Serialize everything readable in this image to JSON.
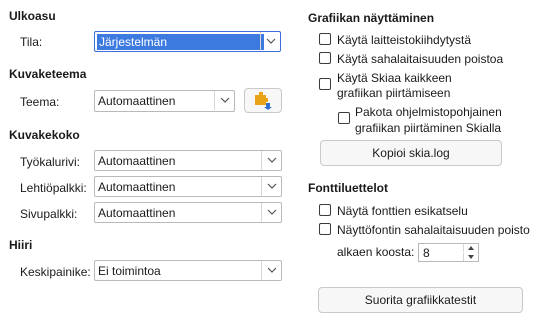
{
  "left": {
    "ulkoasu": {
      "title": "Ulkoasu",
      "mode_label": "Tila:",
      "mode_value": "Järjestelmän"
    },
    "icon_theme": {
      "title": "Kuvaketeema",
      "theme_label": "Teema:",
      "theme_value": "Automaattinen"
    },
    "icon_size": {
      "title": "Kuvakekoko",
      "toolbar_label": "Työkalurivi:",
      "toolbar_value": "Automaattinen",
      "notebookbar_label": "Lehtiöpalkki:",
      "notebookbar_value": "Automaattinen",
      "sidebar_label": "Sivupalkki:",
      "sidebar_value": "Automaattinen"
    },
    "mouse": {
      "title": "Hiiri",
      "middle_label": "Keskipainike:",
      "middle_value": "Ei toimintoa"
    }
  },
  "right": {
    "graphics": {
      "title": "Grafiikan näyttäminen",
      "hw_accel": "Käytä laitteistokiihdytystä",
      "antialias": "Käytä sahalaitaisuuden poistoa",
      "skia_line1": "Käytä Skiaa kaikkeen",
      "skia_line2": "grafiikan piirtämiseen",
      "force_skia_line1": "Pakota ohjelmistopohjainen",
      "force_skia_line2": "grafiikan piirtäminen Skialla",
      "copy_button": "Kopioi skia.log"
    },
    "font_lists": {
      "title": "Fonttiluettelot",
      "preview": "Näytä fonttien esikatselu",
      "font_aa": "Näyttöfontin sahalaitaisuuden poisto",
      "from_size_label": "alkaen koosta:",
      "from_size_value": "8"
    },
    "run_tests_button": "Suorita grafiikkatestit"
  },
  "colors": {
    "accent": "#3d7ae0",
    "icon_orange": "#e8a317",
    "icon_blue": "#2f6fd0"
  }
}
